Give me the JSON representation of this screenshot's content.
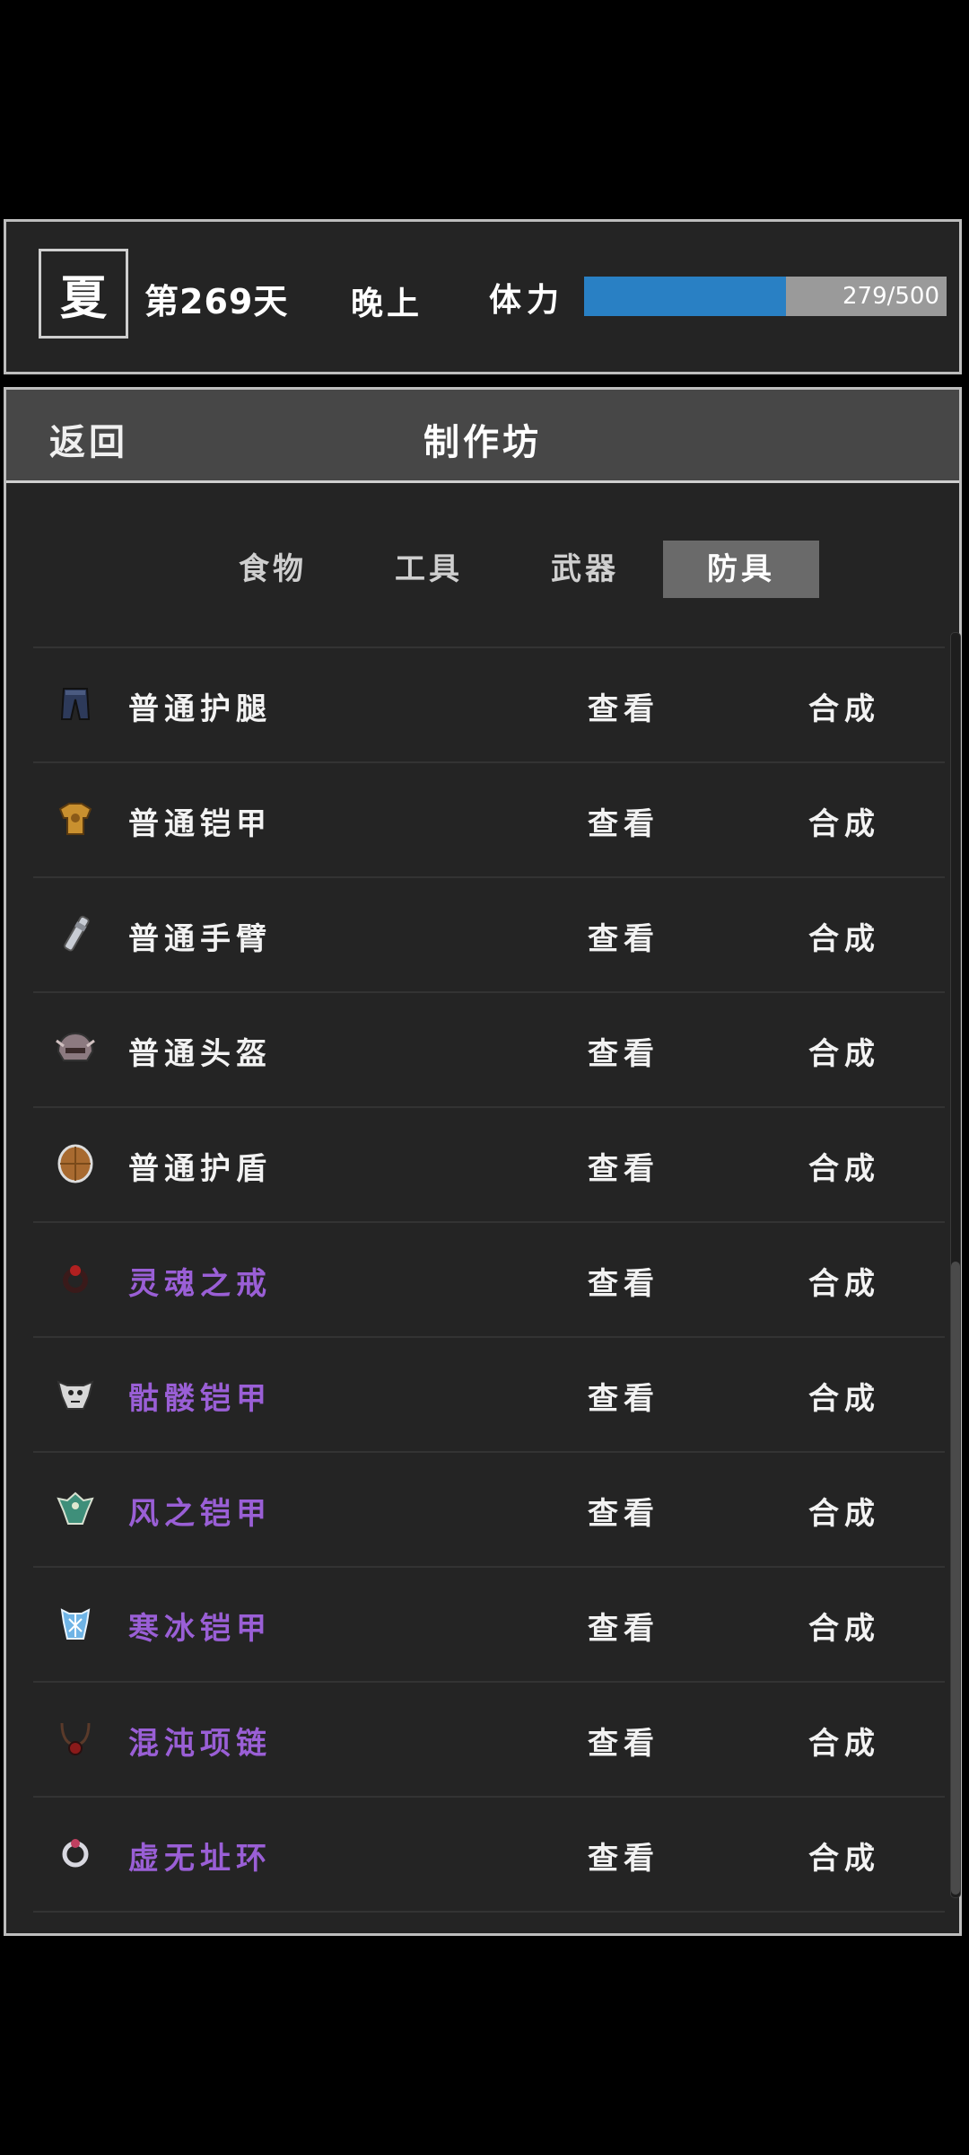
{
  "status": {
    "season": "夏",
    "day": "第269天",
    "time_of_day": "晚上",
    "stamina_label": "体力",
    "stamina_current": 279,
    "stamina_max": 500,
    "stamina_text": "279/500",
    "stamina_color": "#2980c4"
  },
  "workshop": {
    "back_label": "返回",
    "title": "制作坊",
    "tabs": [
      {
        "label": "食物",
        "active": false
      },
      {
        "label": "工具",
        "active": false
      },
      {
        "label": "武器",
        "active": false
      },
      {
        "label": "防具",
        "active": true
      }
    ],
    "view_label": "查看",
    "craft_label": "合成",
    "items": [
      {
        "name": "普通护腿",
        "rare": false,
        "icon": "leggings-icon"
      },
      {
        "name": "普通铠甲",
        "rare": false,
        "icon": "armor-icon"
      },
      {
        "name": "普通手臂",
        "rare": false,
        "icon": "arm-guard-icon"
      },
      {
        "name": "普通头盔",
        "rare": false,
        "icon": "helmet-icon"
      },
      {
        "name": "普通护盾",
        "rare": false,
        "icon": "shield-icon"
      },
      {
        "name": "灵魂之戒",
        "rare": true,
        "icon": "ring-icon"
      },
      {
        "name": "骷髅铠甲",
        "rare": true,
        "icon": "skull-armor-icon"
      },
      {
        "name": "风之铠甲",
        "rare": true,
        "icon": "wind-armor-icon"
      },
      {
        "name": "寒冰铠甲",
        "rare": true,
        "icon": "ice-armor-icon"
      },
      {
        "name": "混沌项链",
        "rare": true,
        "icon": "necklace-icon"
      },
      {
        "name": "虚无址环",
        "rare": true,
        "icon": "void-ring-icon"
      }
    ],
    "rare_color": "#9a5fd6",
    "scroll_position": 0.55
  }
}
